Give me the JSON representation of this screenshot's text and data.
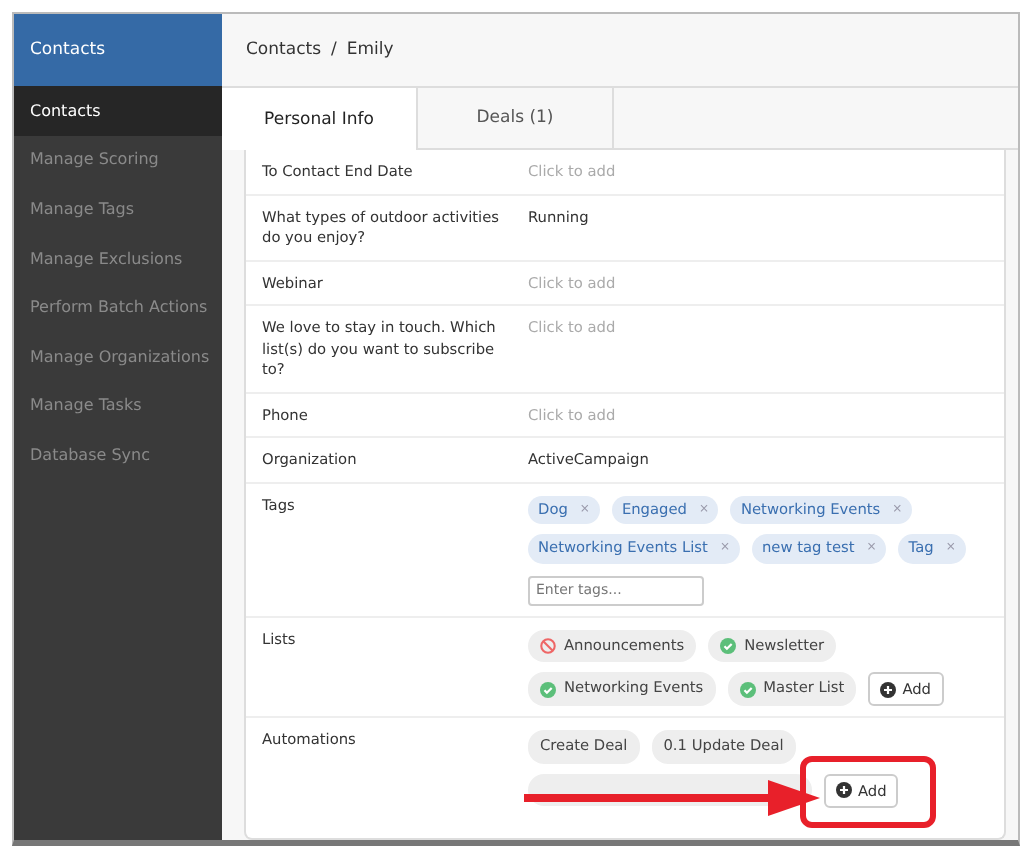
{
  "app_header": {
    "title": "Contacts"
  },
  "sidebar": {
    "items": [
      {
        "label": "Contacts",
        "selected": true
      },
      {
        "label": "Manage Scoring",
        "selected": false
      },
      {
        "label": "Manage Tags",
        "selected": false
      },
      {
        "label": "Manage Exclusions",
        "selected": false
      },
      {
        "label": "Perform Batch Actions",
        "selected": false
      },
      {
        "label": "Manage Organizations",
        "selected": false
      },
      {
        "label": "Manage Tasks",
        "selected": false
      },
      {
        "label": "Database Sync",
        "selected": false
      }
    ]
  },
  "breadcrumb": {
    "parent": "Contacts",
    "separator": "/",
    "current": "Emily"
  },
  "tabs": [
    {
      "label": "Personal Info",
      "selected": true
    },
    {
      "label": "Deals (1)",
      "selected": false
    }
  ],
  "fields": [
    {
      "kind": "text",
      "label": "To Contact End Date",
      "placeholder": "Click to add"
    },
    {
      "kind": "text",
      "label": "What types of outdoor activities do you enjoy?",
      "value": "Running"
    },
    {
      "kind": "text",
      "label": "Webinar",
      "placeholder": "Click to add"
    },
    {
      "kind": "text",
      "label": "We love to stay in touch. Which list(s) do you want to subscribe to?",
      "placeholder": "Click to add"
    },
    {
      "kind": "text",
      "label": "Phone",
      "placeholder": "Click to add"
    },
    {
      "kind": "text",
      "label": "Organization",
      "value": "ActiveCampaign"
    },
    {
      "kind": "tags",
      "label": "Tags",
      "tags": [
        "Dog",
        "Engaged",
        "Networking Events",
        "Networking Events List",
        "new tag test",
        "Tag"
      ],
      "remove_glyph": "×",
      "placeholder": "Enter tags..."
    },
    {
      "kind": "lists",
      "label": "Lists",
      "lists": [
        {
          "name": "Announcements",
          "subscribed": false
        },
        {
          "name": "Newsletter",
          "subscribed": true
        },
        {
          "name": "Networking Events",
          "subscribed": true
        },
        {
          "name": "Master List",
          "subscribed": true
        }
      ],
      "add_label": "Add"
    },
    {
      "kind": "automations",
      "label": "Automations",
      "automations": [
        {
          "name": "Create Deal",
          "obscured": false
        },
        {
          "name": "0.1 Update Deal",
          "obscured": false
        },
        {
          "obscured": true
        }
      ],
      "add_label": "Add",
      "highlighted": true
    }
  ]
}
